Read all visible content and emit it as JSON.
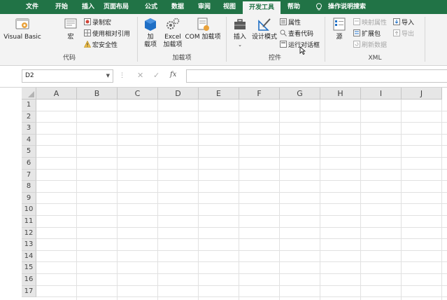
{
  "menu": {
    "tabs": [
      "文件",
      "开始",
      "插入",
      "页面布局",
      "公式",
      "数据",
      "审阅",
      "视图",
      "开发工具",
      "帮助",
      "操作说明搜索"
    ],
    "active_tab": "开发工具"
  },
  "ribbon": {
    "code": {
      "label": "代码",
      "visual_basic": "Visual Basic",
      "macro": "宏",
      "record_macro": "录制宏",
      "relative_ref": "使用相对引用",
      "macro_security": "宏安全性"
    },
    "addins": {
      "label": "加载项",
      "addin_line1": "加",
      "addin_line2": "载项",
      "excel_line1": "Excel",
      "excel_line2": "加载项",
      "com": "COM 加载项"
    },
    "controls": {
      "label": "控件",
      "insert": "插入",
      "design_mode": "设计模式",
      "properties": "属性",
      "view_code": "查看代码",
      "run_dialog": "运行对话框"
    },
    "xml": {
      "label": "XML",
      "source": "源",
      "map_props": "映射属性",
      "expansion_packs": "扩展包",
      "refresh_data": "刷新数据",
      "import": "导入",
      "export": "导出"
    }
  },
  "formula_bar": {
    "name_box": "D2",
    "formula": ""
  },
  "sheet": {
    "columns": [
      "A",
      "B",
      "C",
      "D",
      "E",
      "F",
      "G",
      "H",
      "I",
      "J"
    ],
    "rows": [
      "1",
      "2",
      "3",
      "4",
      "5",
      "6",
      "7",
      "8",
      "9",
      "10",
      "11",
      "12",
      "13",
      "14",
      "15",
      "16",
      "17"
    ]
  },
  "colors": {
    "accent": "#217346",
    "ribbon_bg": "#f3f3f3",
    "header_bg": "#e6e6e6",
    "gridline": "#e1e1e1"
  }
}
